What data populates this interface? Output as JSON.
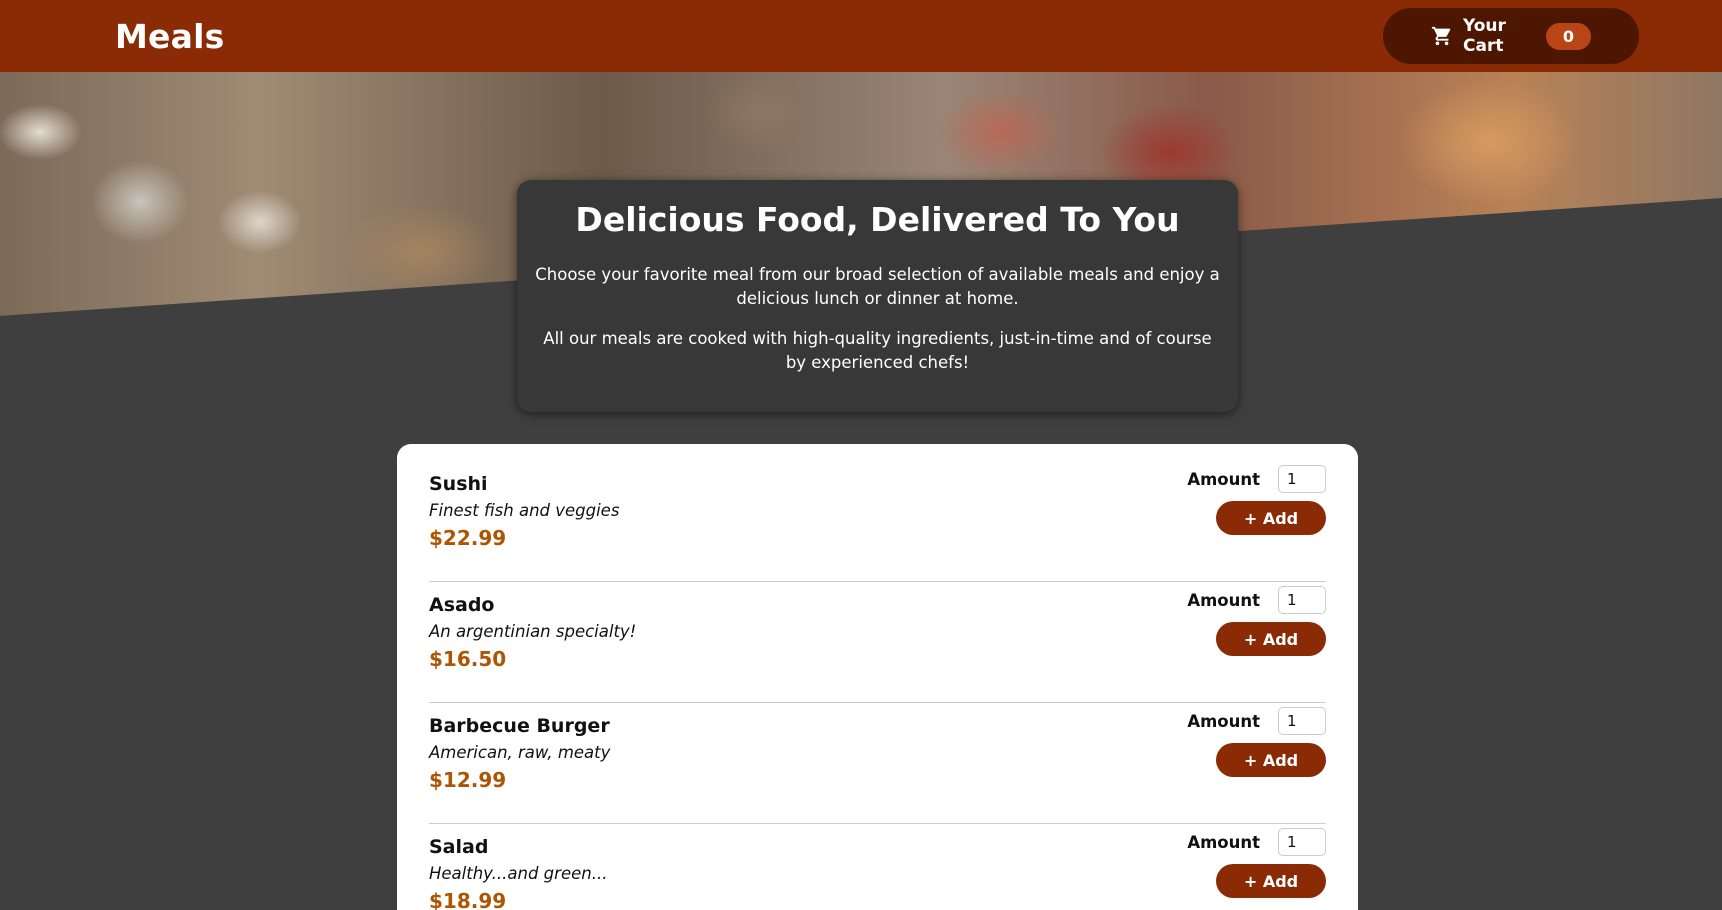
{
  "header": {
    "brand": "Meals",
    "cart_label": "Your Cart",
    "cart_count": "0"
  },
  "summary": {
    "title": "Delicious Food, Delivered To You",
    "paragraph1": "Choose your favorite meal from our broad selection of available meals and enjoy a delicious lunch or dinner at home.",
    "paragraph2": "All our meals are cooked with high-quality ingredients, just-in-time and of course by experienced chefs!"
  },
  "meals": [
    {
      "name": "Sushi",
      "description": "Finest fish and veggies",
      "price": "$22.99",
      "amount_label": "Amount",
      "amount_value": "1",
      "add_label": "+ Add"
    },
    {
      "name": "Asado",
      "description": "An argentinian specialty!",
      "price": "$16.50",
      "amount_label": "Amount",
      "amount_value": "1",
      "add_label": "+ Add"
    },
    {
      "name": "Barbecue Burger",
      "description": "American, raw, meaty",
      "price": "$12.99",
      "amount_label": "Amount",
      "amount_value": "1",
      "add_label": "+ Add"
    },
    {
      "name": "Salad",
      "description": "Healthy...and green...",
      "price": "$18.99",
      "amount_label": "Amount",
      "amount_value": "1",
      "add_label": "+ Add"
    }
  ],
  "colors": {
    "header": "#8a2b06",
    "cart_button": "#4d1601",
    "badge": "#b94517",
    "background": "#3f3f3f",
    "price": "#ad5502"
  },
  "icons": {
    "cart": "shopping-cart-icon"
  }
}
